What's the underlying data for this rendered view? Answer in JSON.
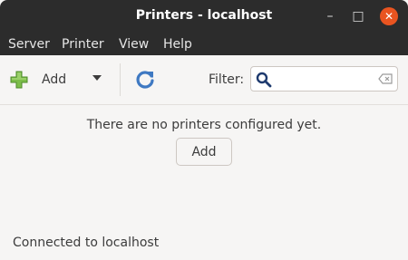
{
  "window": {
    "title": "Printers - localhost",
    "controls": {
      "minimize": "–",
      "maximize": "□",
      "close": "✕"
    }
  },
  "menubar": {
    "items": [
      {
        "label": "Server"
      },
      {
        "label": "Printer"
      },
      {
        "label": "View"
      },
      {
        "label": "Help"
      }
    ]
  },
  "toolbar": {
    "add_label": "Add",
    "add_icon": "plus-icon",
    "refresh_icon": "refresh-icon",
    "filter_label": "Filter:",
    "filter_value": "",
    "search_icon": "search-icon",
    "clear_icon": "clear-icon"
  },
  "main": {
    "empty_message": "There are no printers configured yet.",
    "add_button_label": "Add"
  },
  "statusbar": {
    "text": "Connected to localhost"
  },
  "colors": {
    "titlebar": "#2c2c2c",
    "close_button": "#e95420",
    "background": "#f6f5f4",
    "plus_green": "#7cbd4a",
    "refresh_blue": "#3f79c2"
  }
}
